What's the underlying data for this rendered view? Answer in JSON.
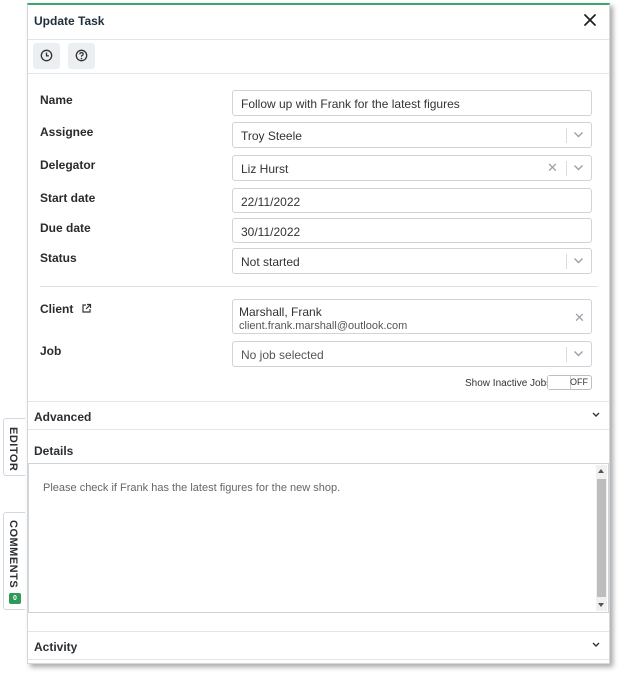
{
  "dialog": {
    "title": "Update Task"
  },
  "toolbar": {
    "history_icon": "clock-icon",
    "help_icon": "question-icon"
  },
  "form": {
    "name": {
      "label": "Name",
      "value": "Follow up with Frank for the latest figures"
    },
    "assignee": {
      "label": "Assignee",
      "value": "Troy Steele"
    },
    "delegator": {
      "label": "Delegator",
      "value": "Liz Hurst"
    },
    "start_date": {
      "label": "Start date",
      "value": "22/11/2022"
    },
    "due_date": {
      "label": "Due date",
      "value": "30/11/2022"
    },
    "status": {
      "label": "Status",
      "value": "Not started"
    },
    "client": {
      "label": "Client",
      "name": "Marshall, Frank",
      "email": "client.frank.marshall@outlook.com",
      "link_icon": "external-link-icon"
    },
    "job": {
      "label": "Job",
      "placeholder": "No job selected"
    },
    "inactive_jobs": {
      "label": "Show Inactive Jobs",
      "state": "OFF"
    }
  },
  "sections": {
    "advanced": "Advanced",
    "details": "Details",
    "details_text": "Please check if Frank has the latest figures for the new shop.",
    "activity": "Activity"
  },
  "side_tabs": {
    "editor": "EDITOR",
    "comments": "COMMENTS",
    "comments_count": "0"
  },
  "colors": {
    "accent": "#3aa86a",
    "badge": "#2e9a57"
  }
}
